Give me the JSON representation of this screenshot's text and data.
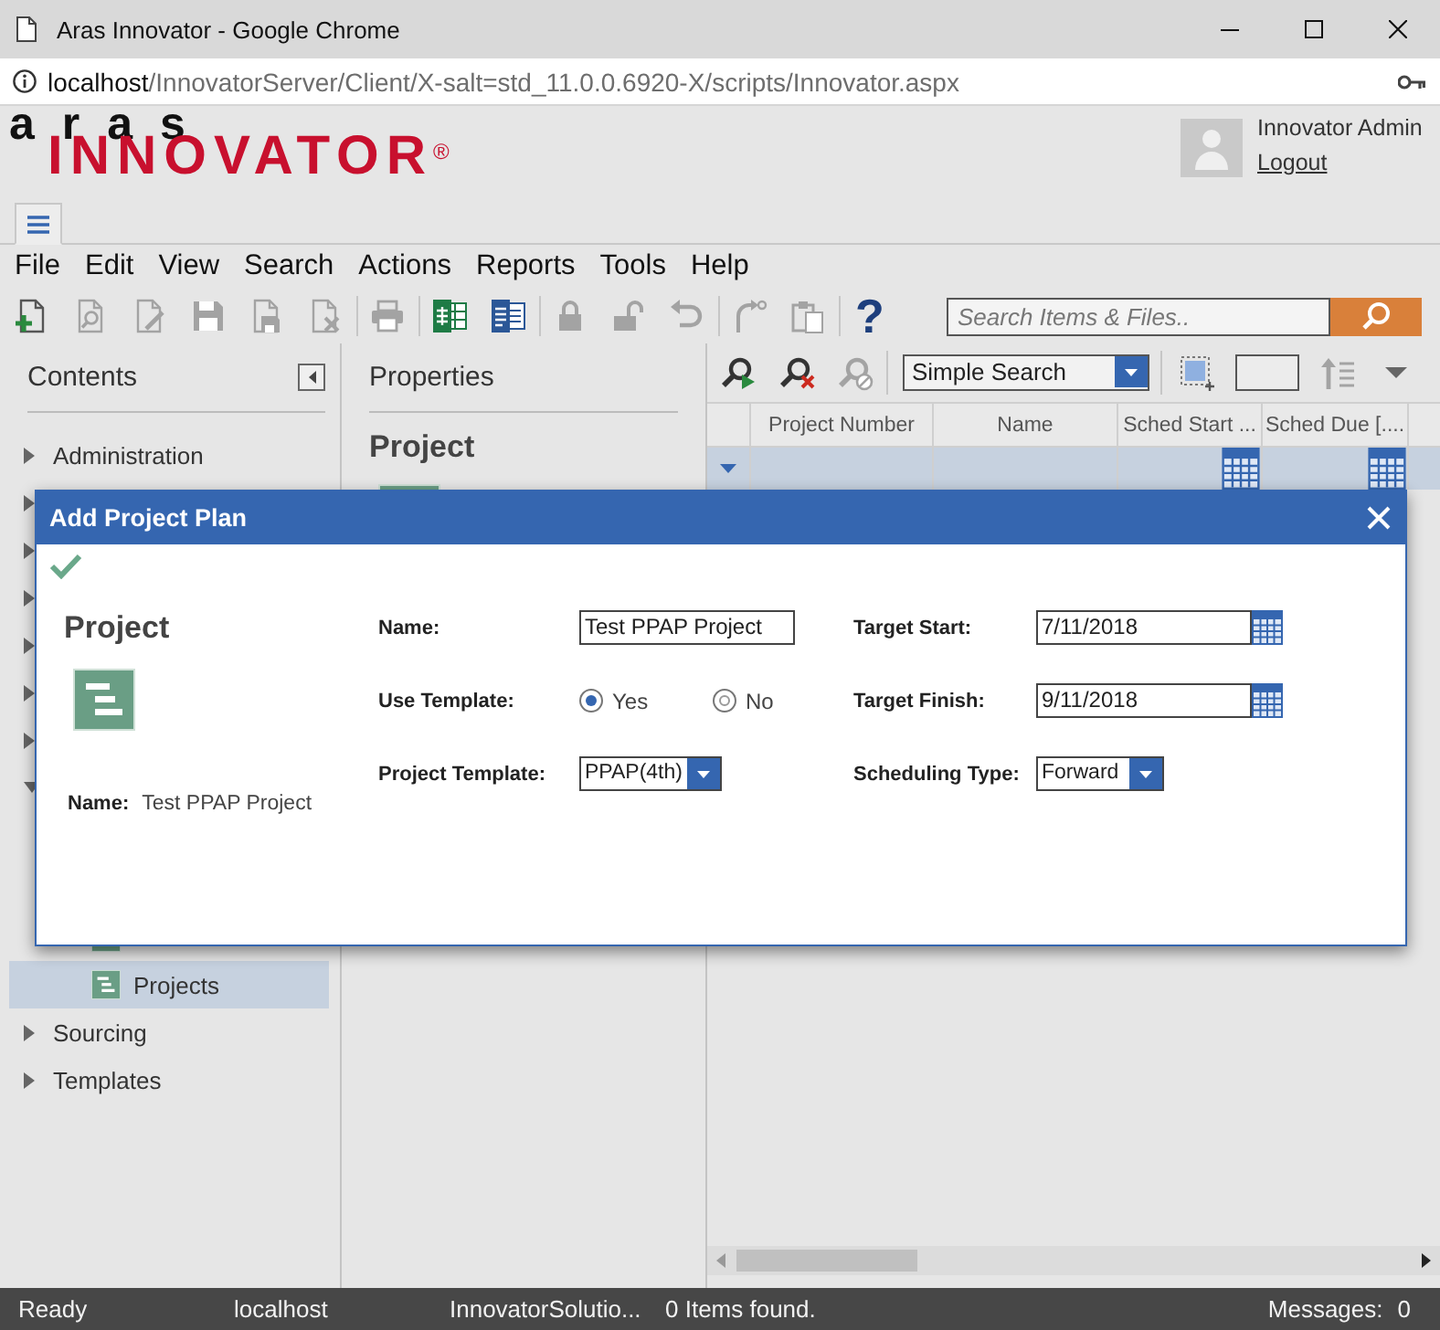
{
  "window": {
    "title": "Aras Innovator - Google Chrome"
  },
  "address_bar": {
    "host": "localhost",
    "path": "/InnovatorServer/Client/X-salt=std_11.0.0.6920-X/scripts/Innovator.aspx"
  },
  "header": {
    "logo": {
      "top": "aras",
      "bottom": "INNOVATOR",
      "mark": "®"
    },
    "user": {
      "name": "Innovator Admin",
      "logout": "Logout"
    }
  },
  "tabs": [
    {
      "kind": "menu",
      "selected": true
    }
  ],
  "menu": [
    "File",
    "Edit",
    "View",
    "Search",
    "Actions",
    "Reports",
    "Tools",
    "Help"
  ],
  "toolbar": {
    "groups": [
      [
        {
          "kind": "new",
          "disabled": false
        },
        {
          "kind": "view",
          "disabled": true
        },
        {
          "kind": "edit",
          "disabled": true
        },
        {
          "kind": "save",
          "disabled": true
        },
        {
          "kind": "save_close",
          "disabled": true
        },
        {
          "kind": "delete",
          "disabled": true
        }
      ],
      [
        {
          "kind": "print",
          "disabled": true
        }
      ],
      [
        {
          "kind": "excel",
          "disabled": false
        },
        {
          "kind": "word",
          "disabled": false
        }
      ],
      [
        {
          "kind": "lock",
          "disabled": true
        },
        {
          "kind": "unlock",
          "disabled": true
        },
        {
          "kind": "undo",
          "disabled": true
        }
      ],
      [
        {
          "kind": "promote",
          "disabled": true
        },
        {
          "kind": "paste",
          "disabled": true
        }
      ],
      [
        {
          "kind": "help",
          "label": "?",
          "disabled": false
        }
      ]
    ],
    "search": {
      "placeholder": "Search Items & Files.."
    }
  },
  "sidebar": {
    "title": "Contents",
    "tree": [
      {
        "label": "Administration",
        "expanded": false
      },
      {
        "expanded": false
      },
      {
        "expanded": false
      },
      {
        "expanded": false
      },
      {
        "expanded": false
      },
      {
        "expanded": false
      },
      {
        "expanded": false
      },
      {
        "expanded": true,
        "children": [
          {
            "selected": false
          },
          {
            "label": "Projects",
            "selected": true
          }
        ]
      },
      {
        "label": "Sourcing",
        "expanded": false
      },
      {
        "label": "Templates",
        "expanded": false
      }
    ]
  },
  "properties": {
    "title": "Properties",
    "item_type": "Project"
  },
  "grid": {
    "toolbar": {
      "search_buttons": [
        {
          "kind": "run",
          "disabled": false
        },
        {
          "kind": "clear",
          "disabled": false
        },
        {
          "kind": "saved",
          "disabled": true
        }
      ],
      "search_mode": "Simple Search",
      "view_tools": [
        {
          "kind": "select_all",
          "disabled": false
        },
        {
          "kind": "page_size",
          "disabled": false
        },
        {
          "kind": "sort",
          "disabled": true
        },
        {
          "kind": "menu",
          "disabled": false
        }
      ]
    },
    "columns": [
      {
        "label": "Project Number",
        "kind": "text"
      },
      {
        "label": "Name",
        "kind": "text"
      },
      {
        "label": "Sched Start ...",
        "kind": "date"
      },
      {
        "label": "Sched Due [....",
        "kind": "date"
      }
    ],
    "rows": [
      {
        "selected": true
      }
    ]
  },
  "dialog": {
    "title": "Add Project Plan",
    "item_type": "Project",
    "summary": {
      "label": "Name:",
      "value": "Test PPAP Project"
    },
    "fields": [
      {
        "label": "Name:",
        "kind": "text",
        "value": "Test PPAP Project"
      },
      {
        "label": "Target Start:",
        "kind": "date",
        "value": "7/11/2018"
      },
      {
        "label": "Use Template:",
        "kind": "radio",
        "options": [
          {
            "label": "Yes",
            "selected": true
          },
          {
            "label": "No",
            "selected": false
          }
        ]
      },
      {
        "label": "Target Finish:",
        "kind": "date",
        "value": "9/11/2018"
      },
      {
        "label": "Project Template:",
        "kind": "select",
        "value": "PPAP(4th)"
      },
      {
        "label": "Scheduling Type:",
        "kind": "select",
        "value": "Forward"
      }
    ]
  },
  "status_bar": {
    "fields": [
      "Ready",
      "localhost",
      "InnovatorSolutio...",
      "0 Items found."
    ],
    "messages": {
      "label": "Messages:",
      "count": "0"
    }
  }
}
